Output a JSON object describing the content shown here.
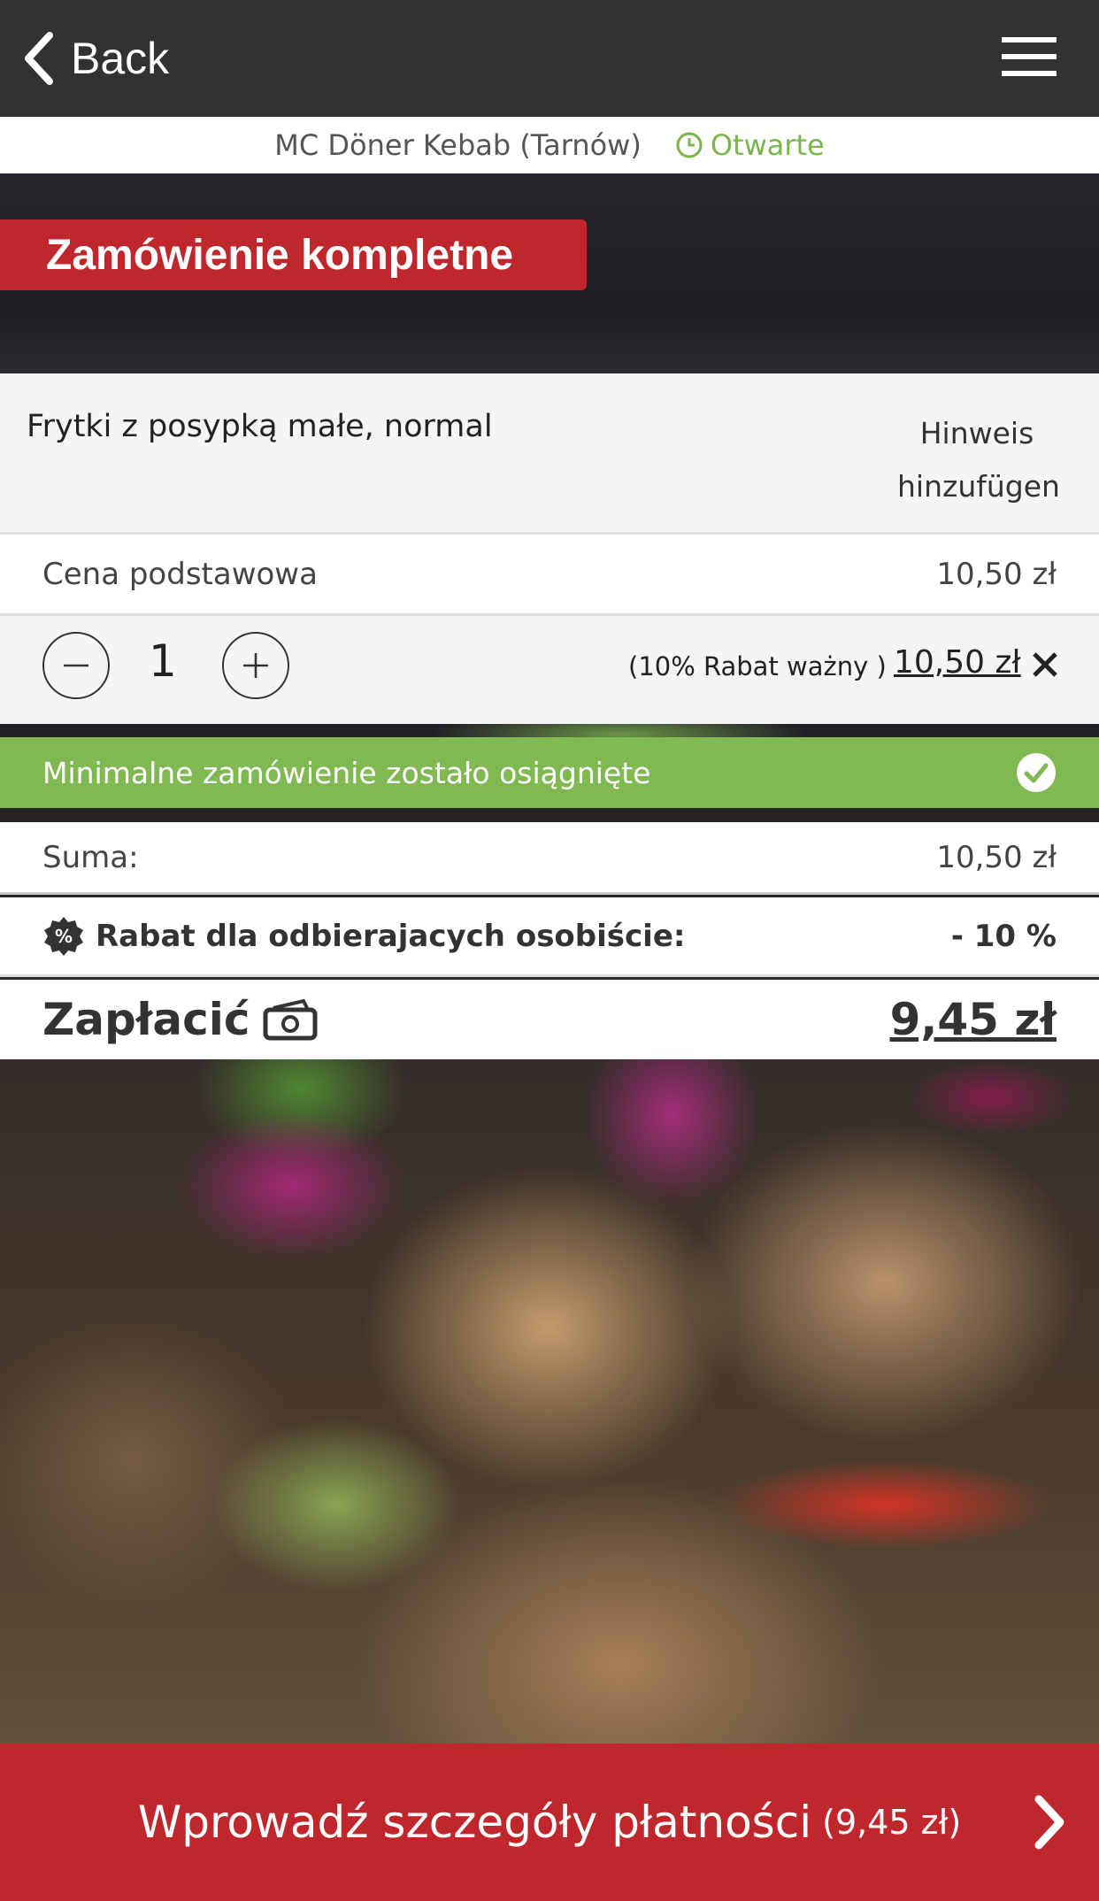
{
  "colors": {
    "accent_red": "#c0272d",
    "success_green": "#80b852",
    "topbar": "#333232"
  },
  "topbar": {
    "back_label": "Back",
    "back_icon": "chevron-left-icon",
    "menu_icon": "hamburger-menu-icon"
  },
  "restaurant": {
    "name": "MC Döner Kebab (Tarnów)",
    "status": "Otwarte",
    "status_icon": "clock-icon"
  },
  "banner": {
    "title": "Zamówienie kompletne"
  },
  "cart": {
    "item_name": "Frytki z posypką małe, normal",
    "hint_line1": "Hinweis",
    "hint_line2": "hinzufügen",
    "base_price_label": "Cena podstawowa",
    "base_price_value": "10,50 zł",
    "quantity": "1",
    "discount_note": "(10% Rabat ważny )",
    "line_price": "10,50 zł"
  },
  "minimum_order": {
    "text": "Minimalne zamówienie zostało osiągnięte",
    "icon": "check-circle-icon"
  },
  "summary": {
    "sum_label": "Suma:",
    "sum_value": "10,50 zł",
    "discount_label": "Rabat dla odbierajacych osobiście:",
    "discount_value": "- 10 %",
    "discount_icon": "percent-badge-icon",
    "pay_label": "Zapłacić",
    "pay_icon": "cash-icon",
    "pay_value": "9,45 zł"
  },
  "cta": {
    "label": "Wprowadź szczegóły płatności",
    "amount": "(9,45 zł)",
    "icon": "chevron-right-icon"
  }
}
